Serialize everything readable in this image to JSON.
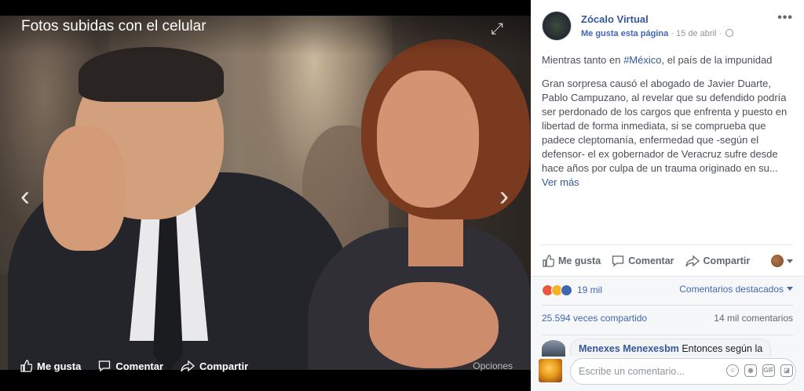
{
  "viewer": {
    "title": "Fotos subidas con el celular",
    "actions": {
      "like": "Me gusta",
      "comment": "Comentar",
      "share": "Compartir"
    },
    "options": "Opciones"
  },
  "post": {
    "page_name": "Zócalo Virtual",
    "like_page": "Me gusta esta página",
    "separator": " · ",
    "date": "15 de abril",
    "line1_prefix": "Mientras tanto en ",
    "hashtag": "#México",
    "line1_suffix": ", el país de la impunidad",
    "body": "Gran sorpresa causó el abogado de Javier Duarte, Pablo Campuzano, al revelar que su defendido podría ser perdonado de los cargos que enfrenta y puesto en libertad de forma inmediata, si se comprueba que padece cleptomanía, enfermedad que -según el defensor- el ex gobernador de Veracruz sufre desde hace años por culpa de un trauma originado en su",
    "ellipsis": "... ",
    "see_more": "Ver más"
  },
  "actions": {
    "like": "Me gusta",
    "comment": "Comentar",
    "share": "Compartir"
  },
  "reactions": {
    "count": "19 mil",
    "top_comments": "Comentarios destacados"
  },
  "stats": {
    "shares": "25.594 veces compartido",
    "comments": "14 mil comentarios"
  },
  "comment": {
    "author": "Menexes Menexesbm",
    "text": " Entonces según la"
  },
  "composer": {
    "placeholder": "Escribe un comentario..."
  },
  "colors": {
    "link": "#365899",
    "accent": "#4267b2",
    "muted": "#90949c"
  }
}
